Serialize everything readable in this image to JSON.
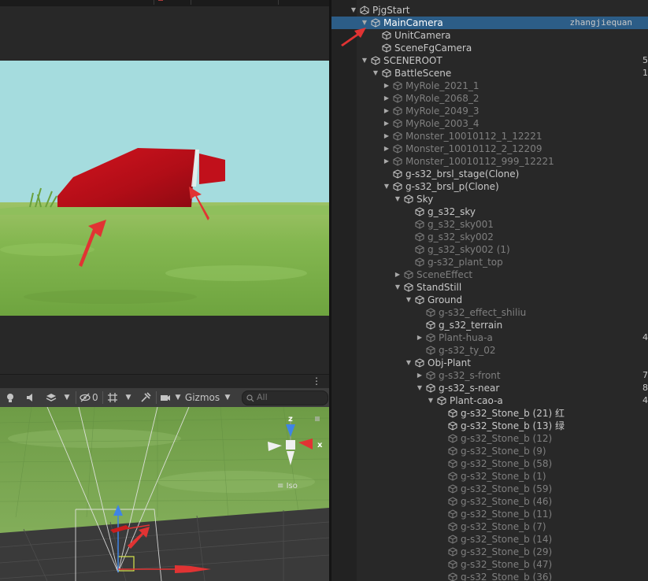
{
  "colors": {
    "accent": "#2c5d87",
    "arrow": "#e13333",
    "text": "#c8c8c8",
    "dim": "#7f7f7f",
    "sky": "#a5dcde",
    "wall": "#c8101a",
    "grass": "#7ab14a"
  },
  "scene_toolbar": {
    "visibility_count": "0",
    "gizmos_label": "Gizmos",
    "search_placeholder": "All"
  },
  "scene_view": {
    "axis_z": "z",
    "axis_x": "x",
    "projection_label": "Iso"
  },
  "hierarchy": {
    "owner_note": "zhangjiequan",
    "rows": [
      {
        "label": "PjgStart",
        "depth": 0,
        "icon": "unity-logo-icon",
        "expanded": true,
        "dim": false,
        "selected": false,
        "edge": ""
      },
      {
        "label": "MainCamera",
        "depth": 1,
        "icon": "gameobject-cube-icon",
        "expanded": true,
        "dim": false,
        "selected": true,
        "edge": ""
      },
      {
        "label": "UnitCamera",
        "depth": 2,
        "icon": "gameobject-cube-icon",
        "expanded": null,
        "dim": false,
        "selected": false,
        "edge": ""
      },
      {
        "label": "SceneFgCamera",
        "depth": 2,
        "icon": "gameobject-cube-icon",
        "expanded": null,
        "dim": false,
        "selected": false,
        "edge": ""
      },
      {
        "label": "SCENEROOT",
        "depth": 1,
        "icon": "gameobject-cube-icon",
        "expanded": true,
        "dim": false,
        "selected": false,
        "edge": "5"
      },
      {
        "label": "BattleScene",
        "depth": 2,
        "icon": "gameobject-cube-icon",
        "expanded": true,
        "dim": false,
        "selected": false,
        "edge": "1"
      },
      {
        "label": "MyRole_2021_1",
        "depth": 3,
        "icon": "gameobject-cube-icon",
        "expanded": false,
        "dim": true,
        "selected": false,
        "edge": ""
      },
      {
        "label": "MyRole_2068_2",
        "depth": 3,
        "icon": "gameobject-cube-icon",
        "expanded": false,
        "dim": true,
        "selected": false,
        "edge": ""
      },
      {
        "label": "MyRole_2049_3",
        "depth": 3,
        "icon": "gameobject-cube-icon",
        "expanded": false,
        "dim": true,
        "selected": false,
        "edge": ""
      },
      {
        "label": "MyRole_2003_4",
        "depth": 3,
        "icon": "gameobject-cube-icon",
        "expanded": false,
        "dim": true,
        "selected": false,
        "edge": ""
      },
      {
        "label": "Monster_10010112_1_12221",
        "depth": 3,
        "icon": "gameobject-cube-icon",
        "expanded": false,
        "dim": true,
        "selected": false,
        "edge": ""
      },
      {
        "label": "Monster_10010112_2_12209",
        "depth": 3,
        "icon": "gameobject-cube-icon",
        "expanded": false,
        "dim": true,
        "selected": false,
        "edge": ""
      },
      {
        "label": "Monster_10010112_999_12221",
        "depth": 3,
        "icon": "gameobject-cube-icon",
        "expanded": false,
        "dim": true,
        "selected": false,
        "edge": ""
      },
      {
        "label": "g-s32_brsl_stage(Clone)",
        "depth": 3,
        "icon": "gameobject-cube-icon",
        "expanded": null,
        "dim": false,
        "selected": false,
        "edge": ""
      },
      {
        "label": "g-s32_brsl_p(Clone)",
        "depth": 3,
        "icon": "gameobject-cube-icon",
        "expanded": true,
        "dim": false,
        "selected": false,
        "edge": ""
      },
      {
        "label": "Sky",
        "depth": 4,
        "icon": "gameobject-cube-icon",
        "expanded": true,
        "dim": false,
        "selected": false,
        "edge": ""
      },
      {
        "label": "g_s32_sky",
        "depth": 5,
        "icon": "gameobject-cube-icon",
        "expanded": null,
        "dim": false,
        "selected": false,
        "edge": ""
      },
      {
        "label": "g_s32_sky001",
        "depth": 5,
        "icon": "gameobject-cube-icon",
        "expanded": null,
        "dim": true,
        "selected": false,
        "edge": ""
      },
      {
        "label": "g_s32_sky002",
        "depth": 5,
        "icon": "gameobject-cube-icon",
        "expanded": null,
        "dim": true,
        "selected": false,
        "edge": ""
      },
      {
        "label": "g_s32_sky002 (1)",
        "depth": 5,
        "icon": "gameobject-cube-icon",
        "expanded": null,
        "dim": true,
        "selected": false,
        "edge": ""
      },
      {
        "label": "g-s32_plant_top",
        "depth": 5,
        "icon": "gameobject-cube-icon",
        "expanded": null,
        "dim": true,
        "selected": false,
        "edge": ""
      },
      {
        "label": "SceneEffect",
        "depth": 4,
        "icon": "gameobject-cube-icon",
        "expanded": false,
        "dim": true,
        "selected": false,
        "edge": ""
      },
      {
        "label": "StandStill",
        "depth": 4,
        "icon": "gameobject-cube-icon",
        "expanded": true,
        "dim": false,
        "selected": false,
        "edge": ""
      },
      {
        "label": "Ground",
        "depth": 5,
        "icon": "gameobject-cube-icon",
        "expanded": true,
        "dim": false,
        "selected": false,
        "edge": ""
      },
      {
        "label": "g-s32_effect_shiliu",
        "depth": 6,
        "icon": "gameobject-cube-icon",
        "expanded": null,
        "dim": true,
        "selected": false,
        "edge": ""
      },
      {
        "label": "g_s32_terrain",
        "depth": 6,
        "icon": "gameobject-cube-icon",
        "expanded": null,
        "dim": false,
        "selected": false,
        "edge": ""
      },
      {
        "label": "Plant-hua-a",
        "depth": 6,
        "icon": "gameobject-cube-icon",
        "expanded": false,
        "dim": true,
        "selected": false,
        "edge": "4"
      },
      {
        "label": "g-s32_ty_02",
        "depth": 6,
        "icon": "gameobject-cube-icon",
        "expanded": null,
        "dim": true,
        "selected": false,
        "edge": ""
      },
      {
        "label": "Obj-Plant",
        "depth": 5,
        "icon": "gameobject-cube-icon",
        "expanded": true,
        "dim": false,
        "selected": false,
        "edge": ""
      },
      {
        "label": "g-s32_s-front",
        "depth": 6,
        "icon": "gameobject-cube-icon",
        "expanded": false,
        "dim": true,
        "selected": false,
        "edge": "7"
      },
      {
        "label": "g-s32_s-near",
        "depth": 6,
        "icon": "gameobject-cube-icon",
        "expanded": true,
        "dim": false,
        "selected": false,
        "edge": "8"
      },
      {
        "label": "Plant-cao-a",
        "depth": 7,
        "icon": "gameobject-cube-icon",
        "expanded": true,
        "dim": false,
        "selected": false,
        "edge": "4"
      },
      {
        "label": "g-s32_Stone_b (21) 红",
        "depth": 8,
        "icon": "gameobject-cube-icon",
        "expanded": null,
        "dim": false,
        "selected": false,
        "edge": ""
      },
      {
        "label": "g-s32_Stone_b (13) 绿",
        "depth": 8,
        "icon": "gameobject-cube-icon",
        "expanded": null,
        "dim": false,
        "selected": false,
        "edge": ""
      },
      {
        "label": "g-s32_Stone_b (12)",
        "depth": 8,
        "icon": "gameobject-cube-icon",
        "expanded": null,
        "dim": true,
        "selected": false,
        "edge": ""
      },
      {
        "label": "g-s32_Stone_b (9)",
        "depth": 8,
        "icon": "gameobject-cube-icon",
        "expanded": null,
        "dim": true,
        "selected": false,
        "edge": ""
      },
      {
        "label": "g-s32_Stone_b (58)",
        "depth": 8,
        "icon": "gameobject-cube-icon",
        "expanded": null,
        "dim": true,
        "selected": false,
        "edge": ""
      },
      {
        "label": "g-s32_Stone_b (1)",
        "depth": 8,
        "icon": "gameobject-cube-icon",
        "expanded": null,
        "dim": true,
        "selected": false,
        "edge": ""
      },
      {
        "label": "g-s32_Stone_b (59)",
        "depth": 8,
        "icon": "gameobject-cube-icon",
        "expanded": null,
        "dim": true,
        "selected": false,
        "edge": ""
      },
      {
        "label": "g-s32_Stone_b (46)",
        "depth": 8,
        "icon": "gameobject-cube-icon",
        "expanded": null,
        "dim": true,
        "selected": false,
        "edge": ""
      },
      {
        "label": "g-s32_Stone_b (11)",
        "depth": 8,
        "icon": "gameobject-cube-icon",
        "expanded": null,
        "dim": true,
        "selected": false,
        "edge": ""
      },
      {
        "label": "g-s32_Stone_b (7)",
        "depth": 8,
        "icon": "gameobject-cube-icon",
        "expanded": null,
        "dim": true,
        "selected": false,
        "edge": ""
      },
      {
        "label": "g-s32_Stone_b (14)",
        "depth": 8,
        "icon": "gameobject-cube-icon",
        "expanded": null,
        "dim": true,
        "selected": false,
        "edge": ""
      },
      {
        "label": "g-s32_Stone_b (29)",
        "depth": 8,
        "icon": "gameobject-cube-icon",
        "expanded": null,
        "dim": true,
        "selected": false,
        "edge": ""
      },
      {
        "label": "g-s32_Stone_b (47)",
        "depth": 8,
        "icon": "gameobject-cube-icon",
        "expanded": null,
        "dim": true,
        "selected": false,
        "edge": ""
      },
      {
        "label": "g-s32_Stone_b (36)",
        "depth": 8,
        "icon": "gameobject-cube-icon",
        "expanded": null,
        "dim": true,
        "selected": false,
        "edge": ""
      }
    ]
  }
}
